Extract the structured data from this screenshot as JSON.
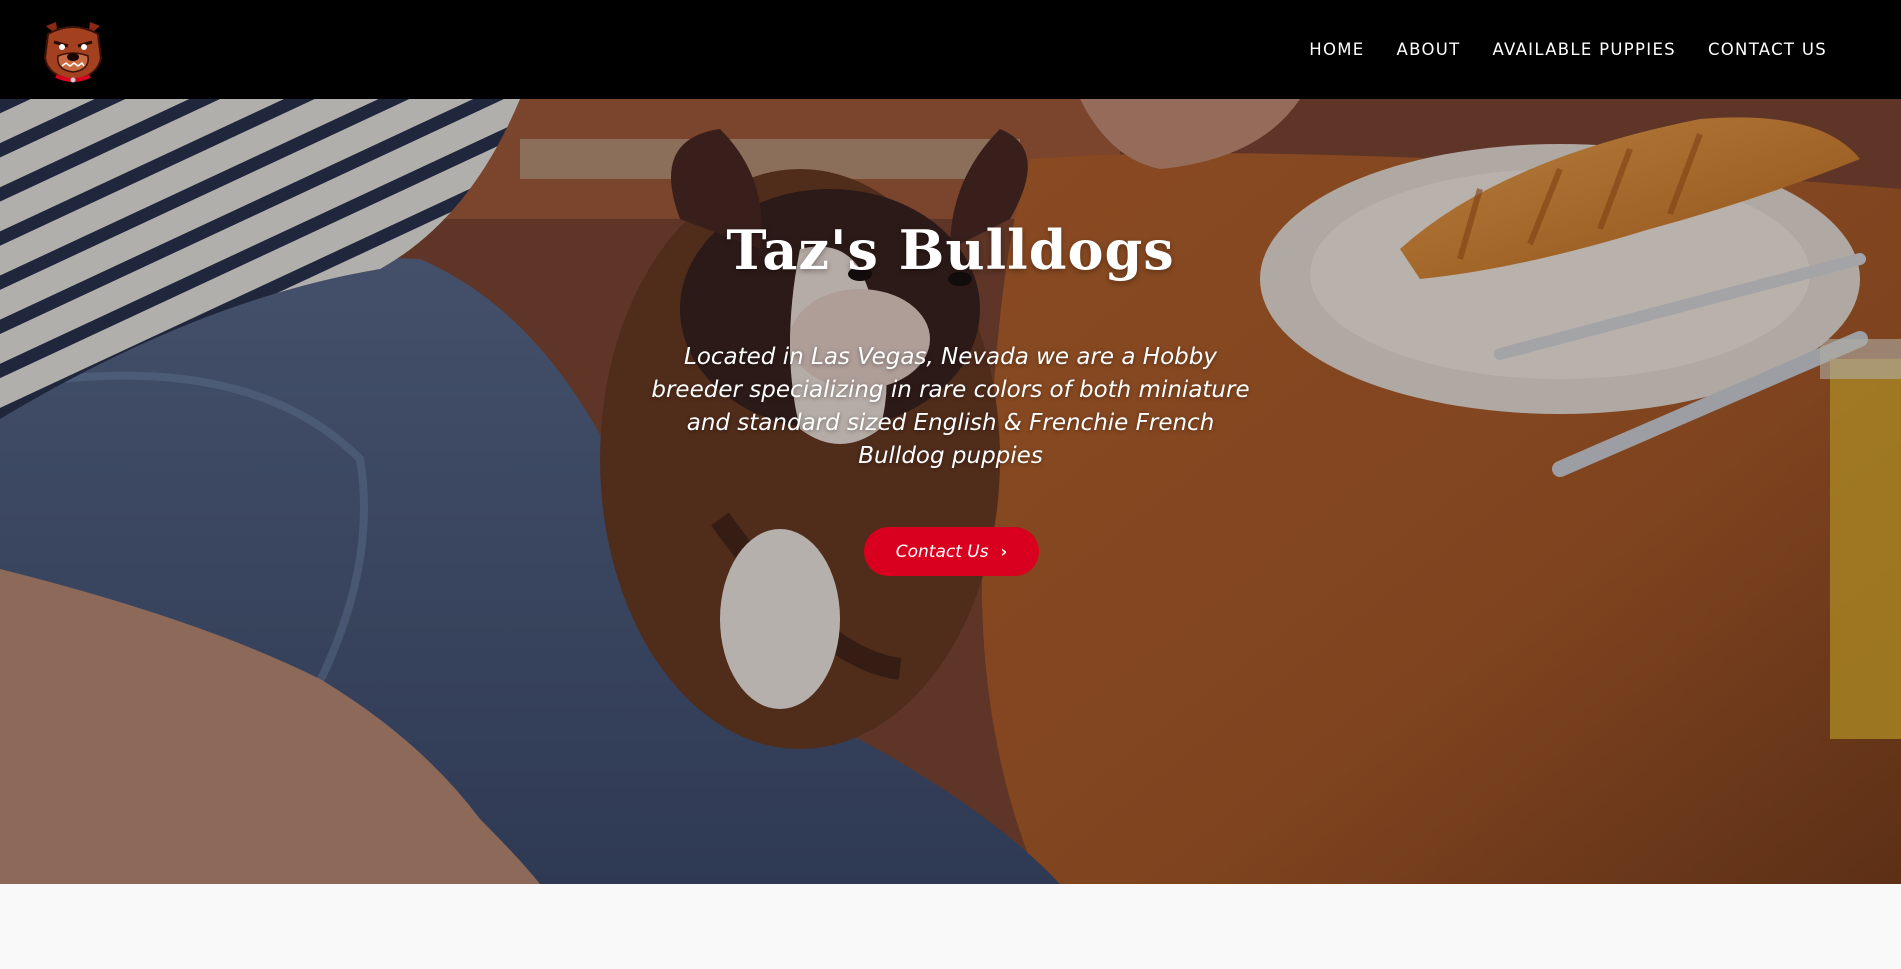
{
  "header": {
    "logo_icon": "bulldog-logo-icon",
    "nav": [
      {
        "label": "HOME"
      },
      {
        "label": "ABOUT"
      },
      {
        "label": "AVAILABLE PUPPIES"
      },
      {
        "label": "CONTACT US"
      }
    ]
  },
  "hero": {
    "title": "Taz's Bulldogs",
    "subtitle": "Located in Las Vegas, Nevada we are a Hobby breeder specializing in rare colors of both miniature and standard sized English & Frenchie French Bulldog puppies",
    "cta_label": "Contact Us",
    "cta_icon": "chevron-right-icon"
  },
  "colors": {
    "header_bg": "#000000",
    "accent": "#d9001f",
    "page_bg": "#f9f9f9"
  }
}
